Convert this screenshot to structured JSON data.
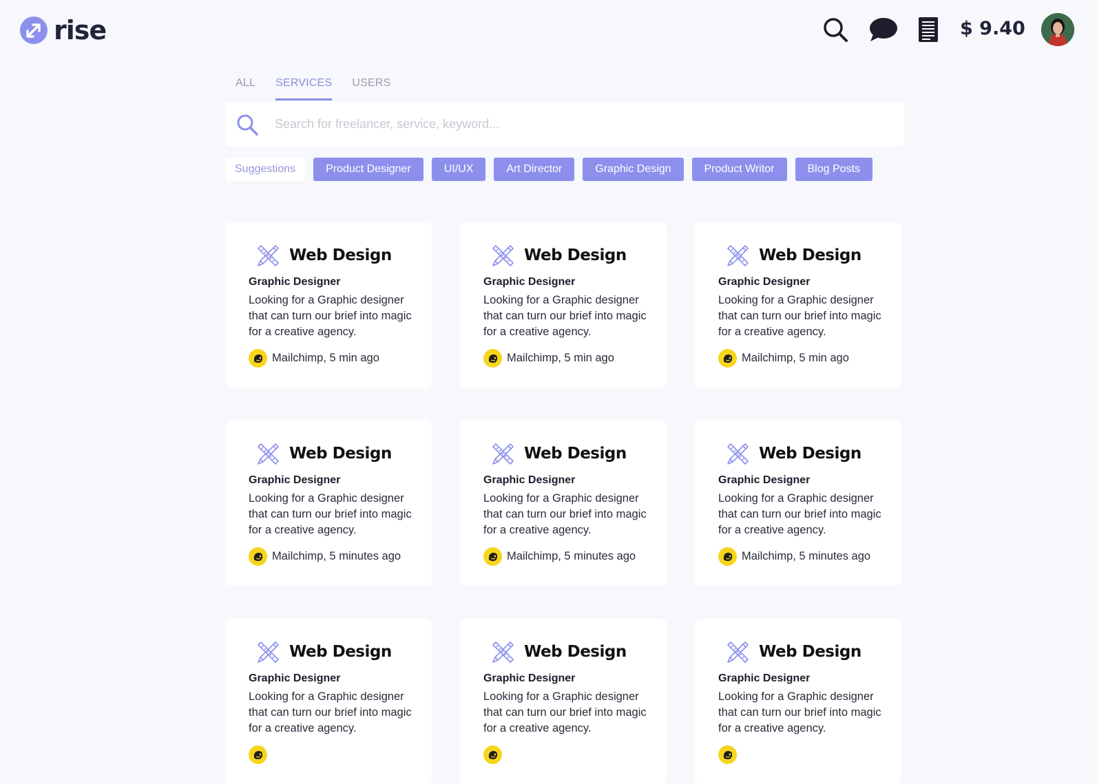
{
  "header": {
    "brand": "rise",
    "balance": "$ 9.40",
    "icons": [
      "search-icon",
      "chat-icon",
      "document-icon"
    ]
  },
  "tabs": [
    {
      "label": "ALL",
      "active": false
    },
    {
      "label": "SERVICES",
      "active": true
    },
    {
      "label": "USERS",
      "active": false
    }
  ],
  "search": {
    "placeholder": "Search for freelancer, service, keyword...",
    "value": ""
  },
  "suggestions": {
    "label": "Suggestions",
    "chips": [
      "Product Designer",
      "UI/UX",
      "Art Director",
      "Graphic Design",
      "Product Writor",
      "Blog Posts"
    ]
  },
  "colors": {
    "accent": "#8c90ec",
    "background": "#f7f8fc",
    "mailchimp_yellow": "#f7d51a"
  },
  "cards": [
    {
      "title": "Web Design",
      "role": "Graphic Designer",
      "description": "Looking for a Graphic designer that can turn our brief into magic for a creative agency.",
      "meta": "Mailchimp, 5 min ago"
    },
    {
      "title": "Web Design",
      "role": "Graphic Designer",
      "description": "Looking for a Graphic designer that can turn our brief into magic for a creative agency.",
      "meta": "Mailchimp, 5 min ago"
    },
    {
      "title": "Web Design",
      "role": "Graphic Designer",
      "description": "Looking for a Graphic designer that can turn our brief into magic for a creative agency.",
      "meta": "Mailchimp, 5 min ago"
    },
    {
      "title": "Web Design",
      "role": "Graphic Designer",
      "description": "Looking for a Graphic designer that can turn our brief into magic for a creative agency.",
      "meta": "Mailchimp, 5 minutes ago"
    },
    {
      "title": "Web Design",
      "role": "Graphic Designer",
      "description": "Looking for a Graphic designer that can turn our brief into magic for a creative agency.",
      "meta": "Mailchimp, 5 minutes ago"
    },
    {
      "title": "Web Design",
      "role": "Graphic Designer",
      "description": "Looking for a Graphic designer that can turn our brief into magic for a creative agency.",
      "meta": "Mailchimp, 5 minutes ago"
    },
    {
      "title": "Web Design",
      "role": "Graphic Designer",
      "description": "Looking for a Graphic designer that can turn our brief into magic for a creative agency.",
      "meta": ""
    },
    {
      "title": "Web Design",
      "role": "Graphic Designer",
      "description": "Looking for a Graphic designer that can turn our brief into magic for a creative agency.",
      "meta": ""
    },
    {
      "title": "Web Design",
      "role": "Graphic Designer",
      "description": "Looking for a Graphic designer that can turn our brief into magic for a creative agency.",
      "meta": ""
    }
  ]
}
